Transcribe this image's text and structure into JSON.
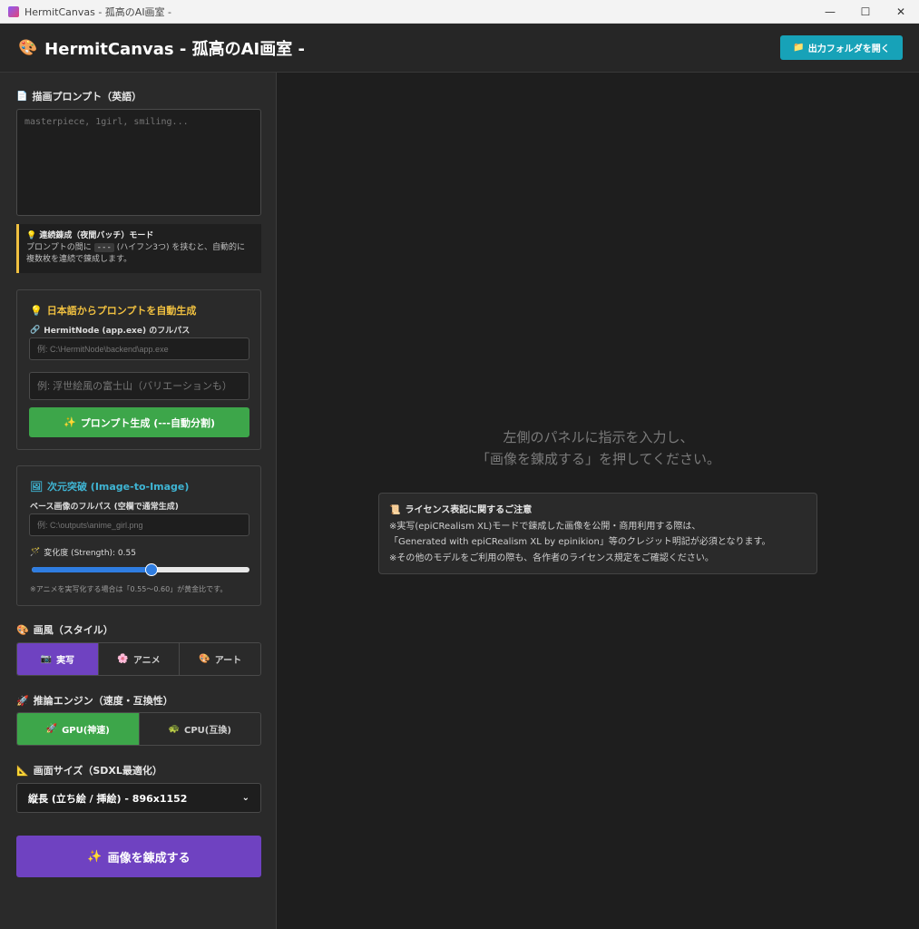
{
  "window": {
    "title": "HermitCanvas - 孤高のAI画室 -",
    "minimize": "—",
    "maximize": "☐",
    "close": "✕"
  },
  "header": {
    "icon": "palette-icon",
    "title": "HermitCanvas - 孤高のAI画室 -",
    "folder_button": "出力フォルダを開く"
  },
  "prompt": {
    "label": "描画プロンプト（英語）",
    "placeholder": "masterpiece, 1girl, smiling..."
  },
  "tip": {
    "title": "連続錬成（夜間バッチ）モード",
    "line1_pre": "プロンプトの間に",
    "code": "---",
    "line1_post": "(ハイフン3つ) を挟むと、自動的に",
    "line2": "複数枚を連続で錬成します。"
  },
  "autogen": {
    "title": "日本語からプロンプトを自動生成",
    "path_label": "HermitNode (app.exe) のフルパス",
    "path_placeholder": "例: C:\\HermitNode\\backend\\app.exe",
    "jp_placeholder": "例: 浮世絵風の富士山（バリエーションも）",
    "button": "プロンプト生成 (---自動分割)"
  },
  "img2img": {
    "title": "次元突破 (Image-to-Image)",
    "base_label": "ベース画像のフルパス (空欄で通常生成)",
    "base_placeholder": "例: C:\\outputs\\anime_girl.png",
    "strength_label": "変化度 (Strength): 0.55",
    "strength_value": 0.55,
    "note": "※アニメを実写化する場合は「0.55～0.60」が黄金比です。"
  },
  "style": {
    "label": "画風（スタイル）",
    "options": [
      "実写",
      "アニメ",
      "アート"
    ],
    "selected": "実写"
  },
  "engine": {
    "label": "推論エンジン（速度・互換性）",
    "options": [
      "GPU(神速)",
      "CPU(互換)"
    ],
    "selected": "GPU(神速)"
  },
  "size": {
    "label": "画面サイズ（SDXL最適化）",
    "selected": "縦長 (立ち絵 / 挿絵) - 896x1152"
  },
  "run_button": "画像を錬成する",
  "main": {
    "placeholder_line1": "左側のパネルに指示を入力し、",
    "placeholder_line2": "「画像を錬成する」を押してください。",
    "license_title": "ライセンス表記に関するご注意",
    "license_line1": "※実写(epiCRealism XL)モードで錬成した画像を公開・商用利用する際は、",
    "license_line2": "「Generated with epiCRealism XL by epinikion」等のクレジット明記が必須となります。",
    "license_line3": "※その他のモデルをご利用の際も、各作者のライセンス規定をご確認ください。"
  },
  "colors": {
    "accent_purple": "#6f42c1",
    "accent_green": "#3da64a",
    "accent_teal": "#17a2b8",
    "slider": "#2f7de1",
    "tip_border": "#f0c040"
  }
}
